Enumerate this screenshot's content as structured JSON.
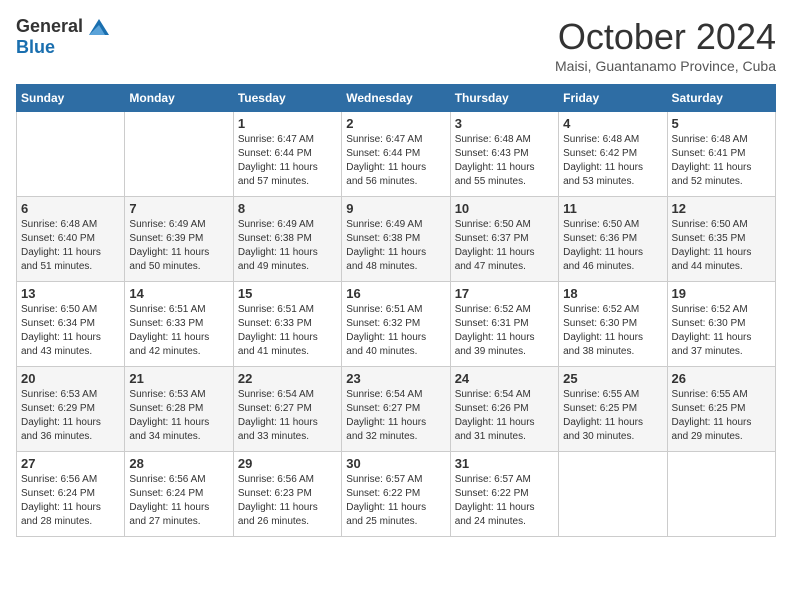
{
  "header": {
    "logo": {
      "general": "General",
      "blue": "Blue"
    },
    "title": "October 2024",
    "subtitle": "Maisi, Guantanamo Province, Cuba"
  },
  "calendar": {
    "columns": [
      "Sunday",
      "Monday",
      "Tuesday",
      "Wednesday",
      "Thursday",
      "Friday",
      "Saturday"
    ],
    "weeks": [
      [
        {
          "day": "",
          "info": ""
        },
        {
          "day": "",
          "info": ""
        },
        {
          "day": "1",
          "info": "Sunrise: 6:47 AM\nSunset: 6:44 PM\nDaylight: 11 hours\nand 57 minutes."
        },
        {
          "day": "2",
          "info": "Sunrise: 6:47 AM\nSunset: 6:44 PM\nDaylight: 11 hours\nand 56 minutes."
        },
        {
          "day": "3",
          "info": "Sunrise: 6:48 AM\nSunset: 6:43 PM\nDaylight: 11 hours\nand 55 minutes."
        },
        {
          "day": "4",
          "info": "Sunrise: 6:48 AM\nSunset: 6:42 PM\nDaylight: 11 hours\nand 53 minutes."
        },
        {
          "day": "5",
          "info": "Sunrise: 6:48 AM\nSunset: 6:41 PM\nDaylight: 11 hours\nand 52 minutes."
        }
      ],
      [
        {
          "day": "6",
          "info": "Sunrise: 6:48 AM\nSunset: 6:40 PM\nDaylight: 11 hours\nand 51 minutes."
        },
        {
          "day": "7",
          "info": "Sunrise: 6:49 AM\nSunset: 6:39 PM\nDaylight: 11 hours\nand 50 minutes."
        },
        {
          "day": "8",
          "info": "Sunrise: 6:49 AM\nSunset: 6:38 PM\nDaylight: 11 hours\nand 49 minutes."
        },
        {
          "day": "9",
          "info": "Sunrise: 6:49 AM\nSunset: 6:38 PM\nDaylight: 11 hours\nand 48 minutes."
        },
        {
          "day": "10",
          "info": "Sunrise: 6:50 AM\nSunset: 6:37 PM\nDaylight: 11 hours\nand 47 minutes."
        },
        {
          "day": "11",
          "info": "Sunrise: 6:50 AM\nSunset: 6:36 PM\nDaylight: 11 hours\nand 46 minutes."
        },
        {
          "day": "12",
          "info": "Sunrise: 6:50 AM\nSunset: 6:35 PM\nDaylight: 11 hours\nand 44 minutes."
        }
      ],
      [
        {
          "day": "13",
          "info": "Sunrise: 6:50 AM\nSunset: 6:34 PM\nDaylight: 11 hours\nand 43 minutes."
        },
        {
          "day": "14",
          "info": "Sunrise: 6:51 AM\nSunset: 6:33 PM\nDaylight: 11 hours\nand 42 minutes."
        },
        {
          "day": "15",
          "info": "Sunrise: 6:51 AM\nSunset: 6:33 PM\nDaylight: 11 hours\nand 41 minutes."
        },
        {
          "day": "16",
          "info": "Sunrise: 6:51 AM\nSunset: 6:32 PM\nDaylight: 11 hours\nand 40 minutes."
        },
        {
          "day": "17",
          "info": "Sunrise: 6:52 AM\nSunset: 6:31 PM\nDaylight: 11 hours\nand 39 minutes."
        },
        {
          "day": "18",
          "info": "Sunrise: 6:52 AM\nSunset: 6:30 PM\nDaylight: 11 hours\nand 38 minutes."
        },
        {
          "day": "19",
          "info": "Sunrise: 6:52 AM\nSunset: 6:30 PM\nDaylight: 11 hours\nand 37 minutes."
        }
      ],
      [
        {
          "day": "20",
          "info": "Sunrise: 6:53 AM\nSunset: 6:29 PM\nDaylight: 11 hours\nand 36 minutes."
        },
        {
          "day": "21",
          "info": "Sunrise: 6:53 AM\nSunset: 6:28 PM\nDaylight: 11 hours\nand 34 minutes."
        },
        {
          "day": "22",
          "info": "Sunrise: 6:54 AM\nSunset: 6:27 PM\nDaylight: 11 hours\nand 33 minutes."
        },
        {
          "day": "23",
          "info": "Sunrise: 6:54 AM\nSunset: 6:27 PM\nDaylight: 11 hours\nand 32 minutes."
        },
        {
          "day": "24",
          "info": "Sunrise: 6:54 AM\nSunset: 6:26 PM\nDaylight: 11 hours\nand 31 minutes."
        },
        {
          "day": "25",
          "info": "Sunrise: 6:55 AM\nSunset: 6:25 PM\nDaylight: 11 hours\nand 30 minutes."
        },
        {
          "day": "26",
          "info": "Sunrise: 6:55 AM\nSunset: 6:25 PM\nDaylight: 11 hours\nand 29 minutes."
        }
      ],
      [
        {
          "day": "27",
          "info": "Sunrise: 6:56 AM\nSunset: 6:24 PM\nDaylight: 11 hours\nand 28 minutes."
        },
        {
          "day": "28",
          "info": "Sunrise: 6:56 AM\nSunset: 6:24 PM\nDaylight: 11 hours\nand 27 minutes."
        },
        {
          "day": "29",
          "info": "Sunrise: 6:56 AM\nSunset: 6:23 PM\nDaylight: 11 hours\nand 26 minutes."
        },
        {
          "day": "30",
          "info": "Sunrise: 6:57 AM\nSunset: 6:22 PM\nDaylight: 11 hours\nand 25 minutes."
        },
        {
          "day": "31",
          "info": "Sunrise: 6:57 AM\nSunset: 6:22 PM\nDaylight: 11 hours\nand 24 minutes."
        },
        {
          "day": "",
          "info": ""
        },
        {
          "day": "",
          "info": ""
        }
      ]
    ]
  }
}
